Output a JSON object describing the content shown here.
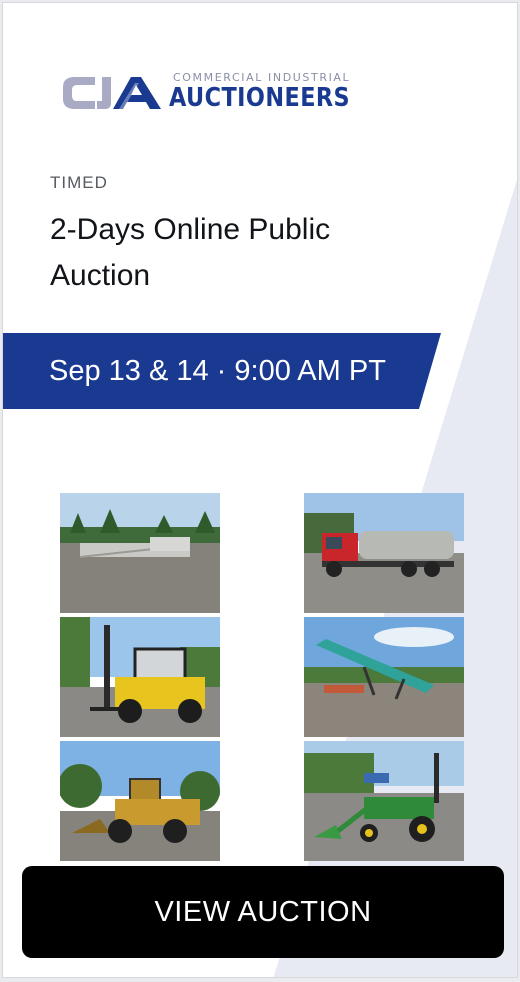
{
  "brand": {
    "tagline": "COMMERCIAL INDUSTRIAL",
    "name": "AUCTIONEERS",
    "mark": "CIA",
    "primary_color": "#1a3990",
    "mark_gray": "#a9abc4"
  },
  "auction": {
    "type": "TIMED",
    "title": "2-Days Online Public Auction",
    "date_label": "Sep 13 & 14 · 9:00 AM PT"
  },
  "photos": [
    {
      "name": "photo-conveyor-parts",
      "subject": "conveyor sections in yard"
    },
    {
      "name": "photo-water-truck",
      "subject": "red water tanker truck"
    },
    {
      "name": "photo-forklift",
      "subject": "yellow forklift"
    },
    {
      "name": "photo-stacker-conveyor",
      "subject": "teal stacker conveyor"
    },
    {
      "name": "photo-wheel-loader",
      "subject": "yellow wheel loader"
    },
    {
      "name": "photo-compact-tractor",
      "subject": "green compact tractor with loader"
    }
  ],
  "cta": {
    "label": "VIEW AUCTION"
  }
}
